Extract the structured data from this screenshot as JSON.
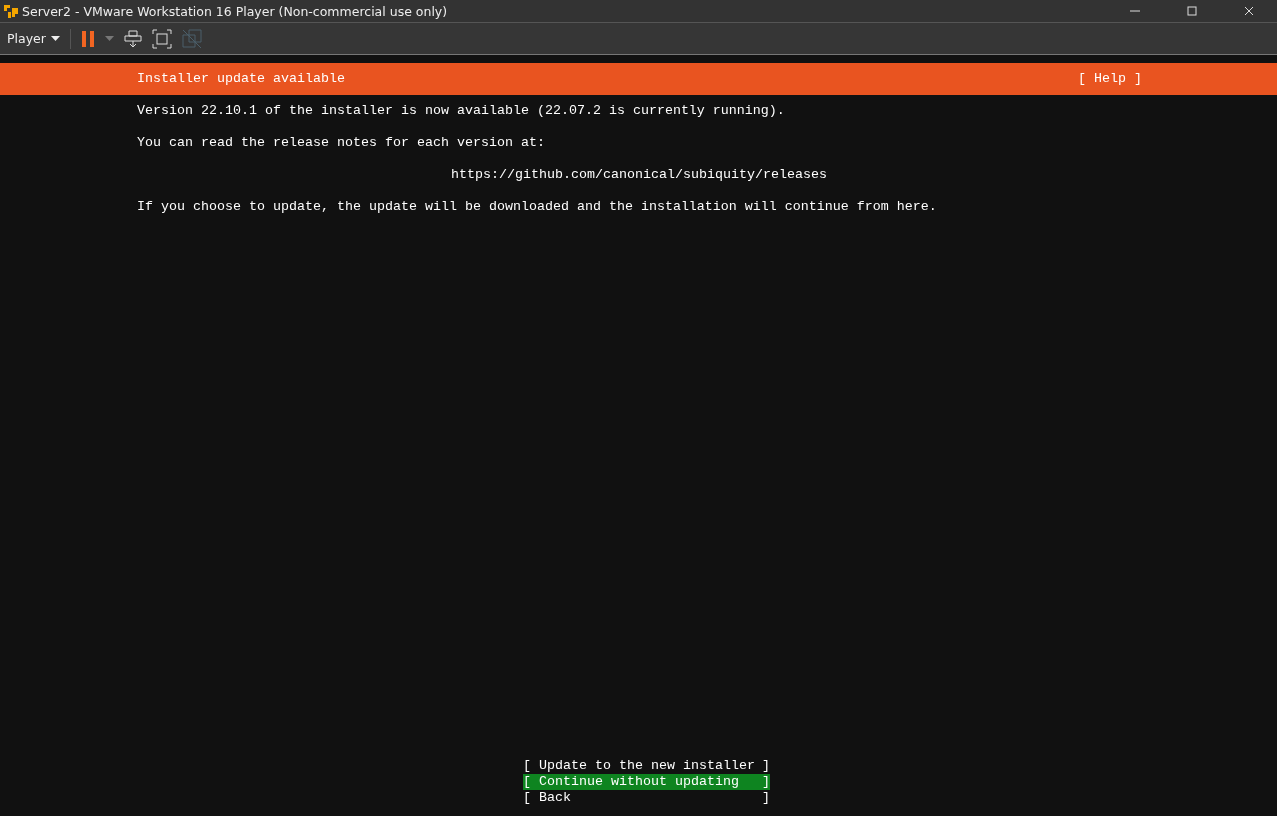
{
  "window": {
    "title": "Server2 - VMware Workstation 16 Player (Non-commercial use only)"
  },
  "toolbar": {
    "menu_label": "Player"
  },
  "installer": {
    "header": {
      "title": "Installer update available",
      "help": "[ Help ]"
    },
    "paragraphs": [
      {
        "kind": "text",
        "text": "Version 22.10.1 of the installer is now available (22.07.2 is currently running)."
      },
      {
        "kind": "text",
        "text": "You can read the release notes for each version at:"
      },
      {
        "kind": "link",
        "text": "https://github.com/canonical/subiquity/releases"
      },
      {
        "kind": "text",
        "text": "If you choose to update, the update will be downloaded and the installation will continue from here."
      }
    ],
    "buttons": [
      {
        "left": "[",
        "label": "Update to the new installer",
        "right": "]",
        "selected": false
      },
      {
        "left": "[",
        "label": "Continue without updating",
        "right": "]",
        "selected": true
      },
      {
        "left": "[",
        "label": "Back",
        "right": "]",
        "selected": false
      }
    ]
  }
}
